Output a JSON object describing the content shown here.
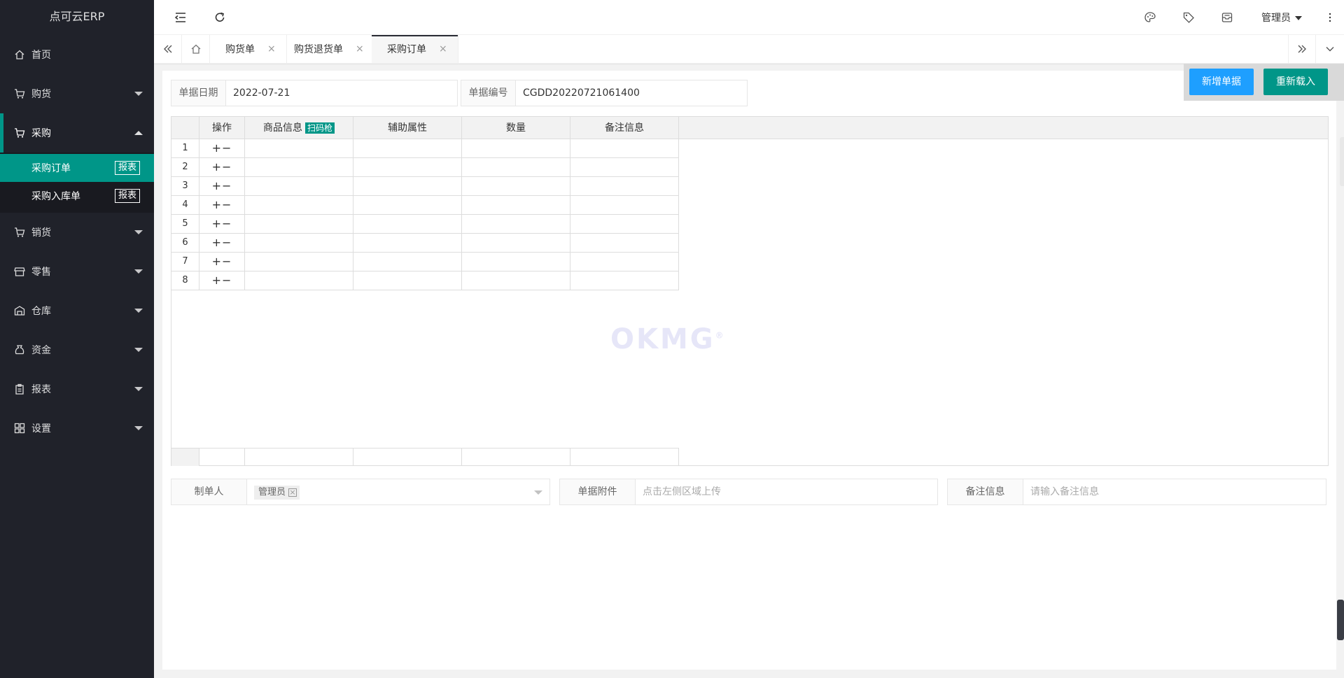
{
  "sidebar": {
    "logo": "点可云ERP",
    "items": [
      {
        "label": "首页"
      },
      {
        "label": "购货"
      },
      {
        "label": "采购"
      },
      {
        "label": "销货"
      },
      {
        "label": "零售"
      },
      {
        "label": "仓库"
      },
      {
        "label": "资金"
      },
      {
        "label": "报表"
      },
      {
        "label": "设置"
      }
    ],
    "sub": [
      {
        "label": "采购订单",
        "tag": "报表"
      },
      {
        "label": "采购入库单",
        "tag": "报表"
      }
    ]
  },
  "header": {
    "user": "管理员"
  },
  "tabs": [
    {
      "label": "购货单"
    },
    {
      "label": "购货退货单"
    },
    {
      "label": "采购订单"
    }
  ],
  "toolbar": {
    "new_label": "新增单据",
    "reload_label": "重新载入"
  },
  "form": {
    "date_label": "单据日期",
    "date_value": "2022-07-21",
    "number_label": "单据编号",
    "number_value": "CGDD20220721061400"
  },
  "grid": {
    "headers": {
      "ops": "操作",
      "goods": "商品信息",
      "scan": "扫码枪",
      "attr": "辅助属性",
      "qty": "数量",
      "remark": "备注信息"
    },
    "ops_symbol": "+−",
    "rows": [
      "1",
      "2",
      "3",
      "4",
      "5",
      "6",
      "7",
      "8"
    ]
  },
  "watermark": "OKMG",
  "bottom": {
    "maker_label": "制单人",
    "maker_value": "管理员",
    "attach_label": "单据附件",
    "attach_placeholder": "点击左侧区域上传",
    "remark_label": "备注信息",
    "remark_placeholder": "请输入备注信息"
  }
}
